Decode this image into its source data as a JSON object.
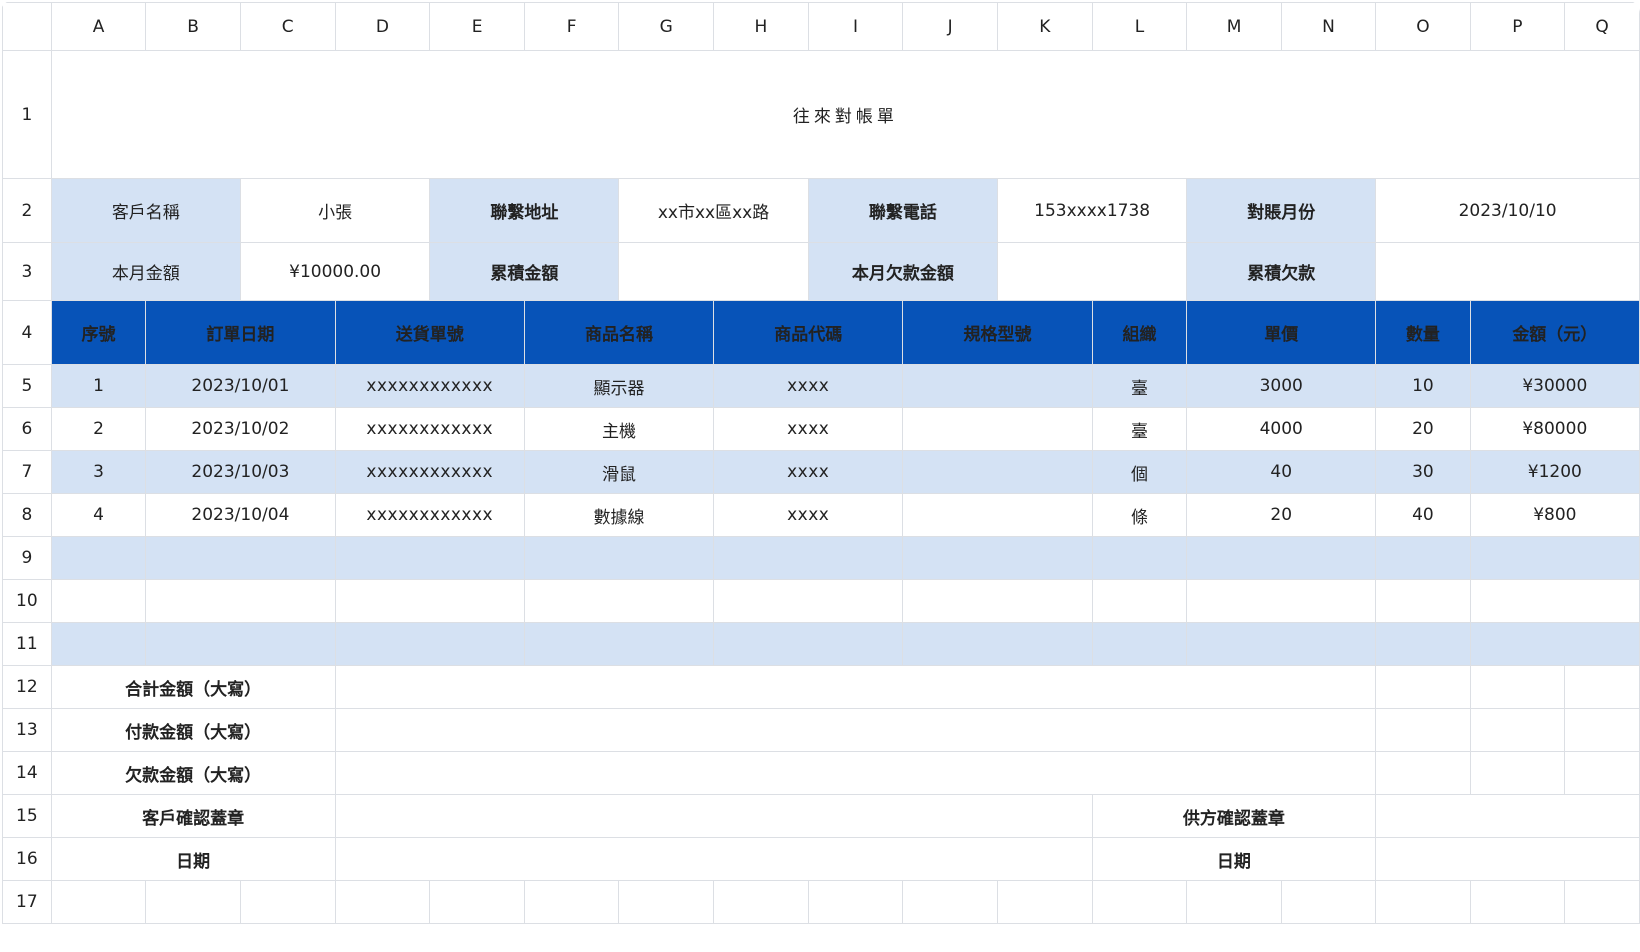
{
  "columns": [
    "A",
    "B",
    "C",
    "D",
    "E",
    "F",
    "G",
    "H",
    "I",
    "J",
    "K",
    "L",
    "M",
    "N",
    "O",
    "P",
    "Q"
  ],
  "rows": [
    "1",
    "2",
    "3",
    "4",
    "5",
    "6",
    "7",
    "8",
    "9",
    "10",
    "11",
    "12",
    "13",
    "14",
    "15",
    "16",
    "17"
  ],
  "title": "往來對帳單",
  "info": {
    "customer_label": "客戶名稱",
    "customer_value": "小張",
    "address_label": "聯繫地址",
    "address_value": "xx市xx區xx路",
    "phone_label": "聯繫電話",
    "phone_value": "153xxxx1738",
    "month_label": "對賬月份",
    "month_value": "2023/10/10",
    "month_amount_label": "本月金額",
    "month_amount_value": "¥10000.00",
    "cumulative_amount_label": "累積金額",
    "cumulative_amount_value": "",
    "month_owed_label": "本月欠款金額",
    "month_owed_value": "",
    "cumulative_owed_label": "累積欠款",
    "cumulative_owed_value": ""
  },
  "table_headers": [
    "序號",
    "訂單日期",
    "送貨單號",
    "商品名稱",
    "商品代碼",
    "規格型號",
    "組織",
    "單價",
    "數量",
    "金額（元）"
  ],
  "items": [
    {
      "no": "1",
      "date": "2023/10/01",
      "delivery": "xxxxxxxxxxxx",
      "name": "顯示器",
      "code": "xxxx",
      "spec": "",
      "unit": "臺",
      "price": "3000",
      "qty": "10",
      "amount": "¥30000"
    },
    {
      "no": "2",
      "date": "2023/10/02",
      "delivery": "xxxxxxxxxxxx",
      "name": "主機",
      "code": "xxxx",
      "spec": "",
      "unit": "臺",
      "price": "4000",
      "qty": "20",
      "amount": "¥80000"
    },
    {
      "no": "3",
      "date": "2023/10/03",
      "delivery": "xxxxxxxxxxxx",
      "name": "滑鼠",
      "code": "xxxx",
      "spec": "",
      "unit": "個",
      "price": "40",
      "qty": "30",
      "amount": "¥1200"
    },
    {
      "no": "4",
      "date": "2023/10/04",
      "delivery": "xxxxxxxxxxxx",
      "name": "數據線",
      "code": "xxxx",
      "spec": "",
      "unit": "條",
      "price": "20",
      "qty": "40",
      "amount": "¥800"
    }
  ],
  "footer": {
    "total_caps_label": "合計金額（大寫）",
    "paid_caps_label": "付款金額（大寫）",
    "owed_caps_label": "欠款金額（大寫）",
    "customer_seal_label": "客戶確認蓋章",
    "supplier_seal_label": "供方確認蓋章",
    "date_label_left": "日期",
    "date_label_right": "日期"
  },
  "colors": {
    "accent": "#0753b8",
    "band": "#d4e2f4",
    "title": "#0a56b3",
    "grid": "#dcdfe4"
  },
  "icons": {
    "toolbar": [
      "eye-icon",
      "freeze-col-icon",
      "freeze-row-icon"
    ]
  }
}
